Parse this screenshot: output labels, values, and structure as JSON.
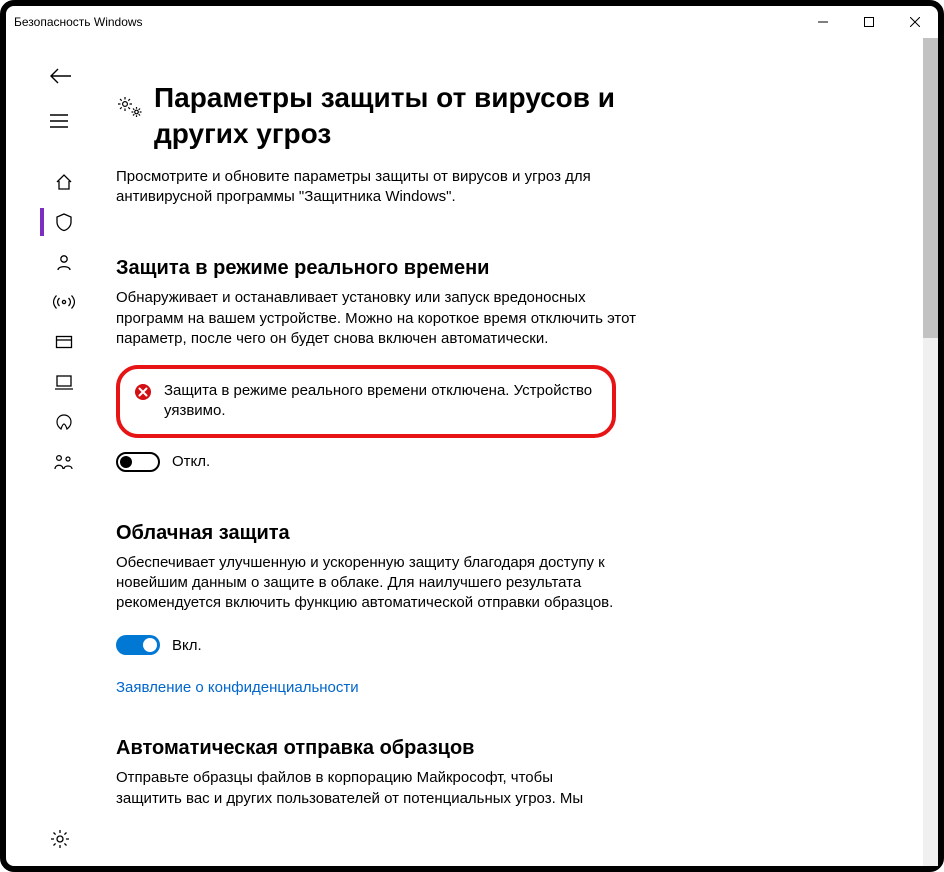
{
  "titlebar": {
    "caption": "Безопасность Windows"
  },
  "page": {
    "title": "Параметры защиты от вирусов и других угроз",
    "description": "Просмотрите и обновите параметры защиты от вирусов и угроз для антивирусной программы \"Защитника Windows\"."
  },
  "realtime": {
    "title": "Защита в режиме реального времени",
    "description": "Обнаруживает и останавливает установку или запуск вредоносных программ на вашем устройстве. Можно на короткое время отключить этот параметр, после чего он будет снова включен автоматически.",
    "warning": "Защита в режиме реального времени отключена. Устройство уязвимо.",
    "toggle_label": "Откл."
  },
  "cloud": {
    "title": "Облачная защита",
    "description": "Обеспечивает улучшенную и ускоренную защиту благодаря доступу к новейшим данным о защите в облаке. Для наилучшего результата рекомендуется включить функцию автоматической отправки образцов.",
    "toggle_label": "Вкл.",
    "privacy_link": "Заявление о конфиденциальности"
  },
  "autosend": {
    "title": "Автоматическая отправка образцов",
    "description": "Отправьте образцы файлов в корпорацию Майкрософт, чтобы защитить вас и других пользователей от потенциальных угроз. Мы"
  }
}
